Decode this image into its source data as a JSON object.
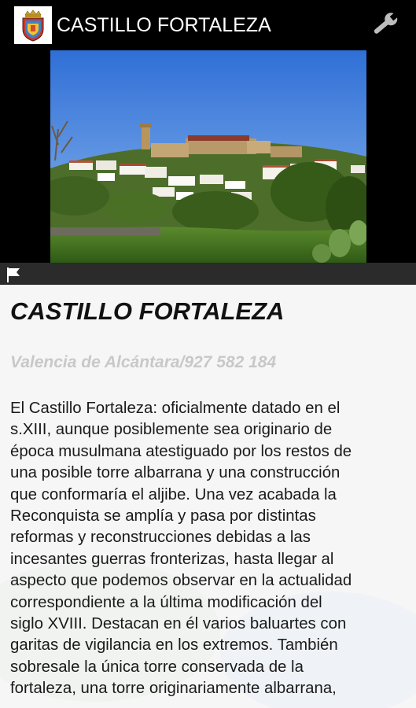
{
  "app_bar": {
    "title": "CASTILLO FORTALEZA",
    "logo_icon": "coat-of-arms-icon",
    "settings_icon": "wrench-icon"
  },
  "photo": {
    "description_icon": "castle-town-photo",
    "map_icon": "flag-icon"
  },
  "content": {
    "title": "CASTILLO FORTALEZA",
    "subtitle": "Valencia de Alcántara/927 582 184",
    "description_lines": [
      "El Castillo Fortaleza: oficialmente datado en el",
      "s.XIII, aunque posiblemente sea originario de",
      "época musulmana atestiguado por los restos de",
      "una posible torre albarrana y una construcción",
      "que conformaría el aljibe. Una vez acabada la",
      "Reconquista se amplía y pasa por distintas",
      "reformas y reconstrucciones debidas a las",
      "incesantes guerras fronterizas, hasta llegar al",
      "aspecto que podemos observar en la actualidad",
      "correspondiente a la última modificación del",
      "siglo XVIII. Destacan en él varios baluartes con",
      "garitas de vigilancia en los extremos. También",
      "sobresale la única torre conservada de la",
      "fortaleza, una torre originariamente albarrana,"
    ]
  },
  "colors": {
    "app_bar_bg": "#000000",
    "map_bar_bg": "#2b2b2b",
    "subtitle": "#c8c8c8",
    "text": "#1a1a1a"
  }
}
